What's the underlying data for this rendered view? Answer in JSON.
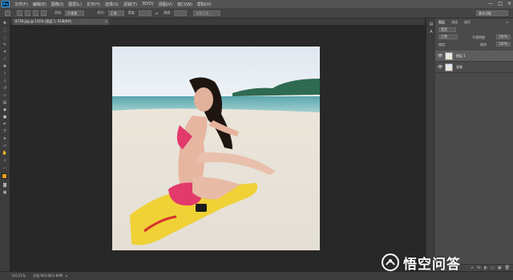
{
  "app": {
    "logo_text": "Ps"
  },
  "menubar": {
    "items": [
      "文件(F)",
      "编辑(E)",
      "图像(I)",
      "图层(L)",
      "文字(Y)",
      "选择(S)",
      "滤镜(T)",
      "3D(D)",
      "视图(V)",
      "窗口(W)",
      "帮助(H)"
    ],
    "window_buttons": [
      "—",
      "□",
      "×"
    ]
  },
  "options": {
    "feather_label": "羽化:",
    "feather_value": "0 像素",
    "style_label": "样式:",
    "style_value": "正常",
    "width_label": "宽度:",
    "height_label": "高度:",
    "refine_label": "调整边缘...",
    "workspace_value": "基本功能"
  },
  "document": {
    "tab_title": "8739.jpg @ 116% (图层 1, RGB/8#)",
    "close": "×"
  },
  "status": {
    "zoom": "116.21%",
    "doc_info": "文档:963.6K/1.89M"
  },
  "panels": {
    "tabs": [
      "图层",
      "通道",
      "路径"
    ],
    "kind_label": "类型",
    "blend_mode": "正常",
    "opacity_label": "不透明度:",
    "opacity_value": "100%",
    "lock_label": "锁定:",
    "fill_label": "填充:",
    "fill_value": "100%",
    "layers": [
      {
        "name": "图层 1"
      },
      {
        "name": "背景"
      }
    ],
    "footer_icons": [
      "∞",
      "fx",
      "◐",
      "▭",
      "▣",
      "🗑"
    ]
  },
  "watermark": {
    "text": "悟空问答"
  }
}
